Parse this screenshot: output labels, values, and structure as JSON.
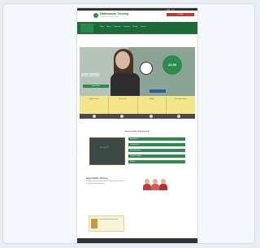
{
  "header": {
    "logo_text": "Mathnasium Tutoring",
    "logo_tagline": "The Math Learning Center",
    "phone_label": "Call Now"
  },
  "nav": {
    "items": [
      "Home",
      "About",
      "Programs",
      "Locations",
      "Results",
      "Contact"
    ]
  },
  "hero": {
    "price": "22.90",
    "headline": "MATHS TUTORING",
    "subline": "FOR ALL YEAR LEVELS",
    "pill_label": "Book Now"
  },
  "features": [
    {
      "label": "Qualified Tutors"
    },
    {
      "label": "One on One"
    },
    {
      "label": "All Ages"
    },
    {
      "label": "Free Assessment"
    }
  ],
  "middle": {
    "heading": "How does Maths Tutoring work?",
    "board_text": "x² + y = ?",
    "options": [
      {
        "label": "Assessment"
      },
      {
        "label": "Learning Plan"
      },
      {
        "label": "Weekly Sessions"
      },
      {
        "label": "Progress Reports"
      },
      {
        "label": "Results"
      }
    ]
  },
  "bottom": {
    "title": "Expert Maths Tutoring",
    "text": "Our maths tutors help students build confidence and achieve better results through tailored sessions.",
    "promo_text": "Free Maths Workbook Download"
  },
  "colors": {
    "brand_green": "#1e6b3a",
    "accent_yellow": "#f2e58a",
    "price_badge": "#2d8b4b"
  }
}
